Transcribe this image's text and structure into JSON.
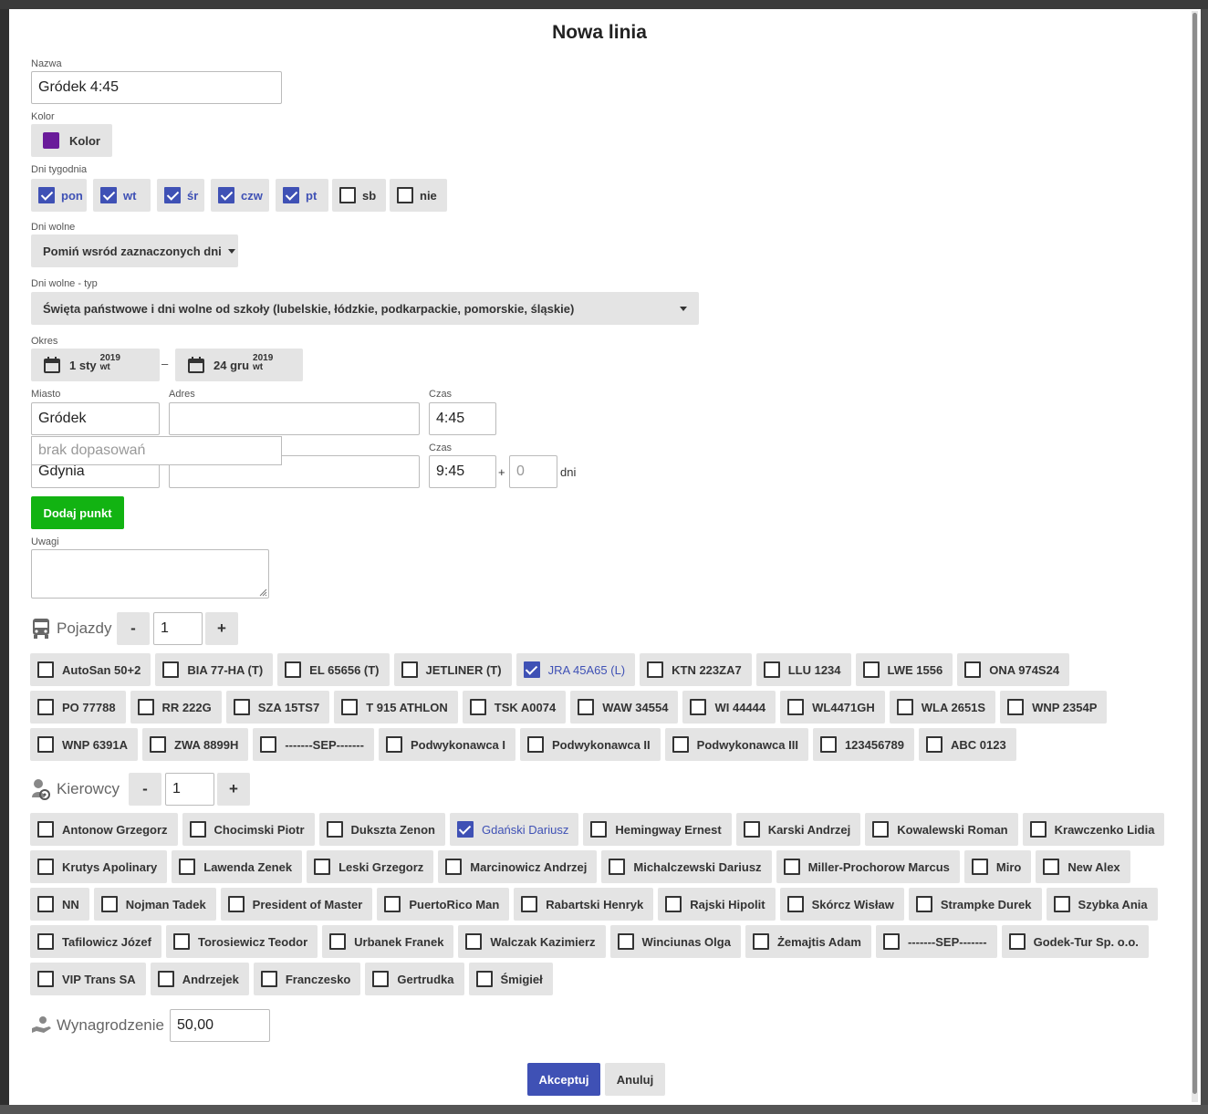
{
  "dialog": {
    "title": "Nowa linia"
  },
  "name": {
    "label": "Nazwa",
    "value": "Gródek 4:45"
  },
  "color": {
    "label": "Kolor",
    "button_label": "Kolor",
    "swatch": "#6a1b9a"
  },
  "weekdays": {
    "label": "Dni tygodnia",
    "items": [
      {
        "label": "pon",
        "checked": true
      },
      {
        "label": "wt",
        "checked": true
      },
      {
        "label": "śr",
        "checked": true
      },
      {
        "label": "czw",
        "checked": true
      },
      {
        "label": "pt",
        "checked": true
      },
      {
        "label": "sb",
        "checked": false
      },
      {
        "label": "nie",
        "checked": false
      }
    ]
  },
  "holidays": {
    "label": "Dni wolne",
    "value": "Pomiń wsród zaznaczonych dni"
  },
  "holiday_type": {
    "label": "Dni wolne - typ",
    "value": "Święta państwowe i dni wolne od szkoły (lubelskie, łódzkie, podkarpackie, pomorskie, śląskie)"
  },
  "period": {
    "label": "Okres",
    "separator": "–",
    "from": {
      "day": "1 sty",
      "year": "2019",
      "weekday": "wt"
    },
    "to": {
      "day": "24 gru",
      "year": "2019",
      "weekday": "wt"
    }
  },
  "route": {
    "labels": {
      "city": "Miasto",
      "address": "Adres",
      "time": "Czas"
    },
    "start": {
      "city": "Gródek",
      "address": "",
      "time": "4:45"
    },
    "autocomplete": "brak dopasowań",
    "end": {
      "city": "Gdynia",
      "address": "",
      "time": "9:45",
      "plus": "+",
      "days_placeholder": "0",
      "days_unit": "dni"
    },
    "add_point_label": "Dodaj punkt"
  },
  "notes": {
    "label": "Uwagi",
    "value": ""
  },
  "vehicles": {
    "title": "Pojazdy",
    "minus": "-",
    "plus": "+",
    "count": "1",
    "items": [
      {
        "label": "AutoSan 50+2",
        "checked": false
      },
      {
        "label": "BIA 77-HA (T)",
        "checked": false
      },
      {
        "label": "EL 65656 (T)",
        "checked": false
      },
      {
        "label": "JETLINER (T)",
        "checked": false
      },
      {
        "label": "JRA 45A65 (L)",
        "checked": true
      },
      {
        "label": "KTN 223ZA7",
        "checked": false
      },
      {
        "label": "LLU 1234",
        "checked": false
      },
      {
        "label": "LWE 1556",
        "checked": false
      },
      {
        "label": "ONA 974S24",
        "checked": false
      },
      {
        "label": "PO 77788",
        "checked": false
      },
      {
        "label": "RR 222G",
        "checked": false
      },
      {
        "label": "SZA 15TS7",
        "checked": false
      },
      {
        "label": "T 915 ATHLON",
        "checked": false
      },
      {
        "label": "TSK A0074",
        "checked": false
      },
      {
        "label": "WAW 34554",
        "checked": false
      },
      {
        "label": "WI 44444",
        "checked": false
      },
      {
        "label": "WL4471GH",
        "checked": false
      },
      {
        "label": "WLA 2651S",
        "checked": false
      },
      {
        "label": "WNP 2354P",
        "checked": false
      },
      {
        "label": "WNP 6391A",
        "checked": false
      },
      {
        "label": "ZWA 8899H",
        "checked": false
      },
      {
        "label": "-------SEP-------",
        "checked": false
      },
      {
        "label": "Podwykonawca I",
        "checked": false
      },
      {
        "label": "Podwykonawca II",
        "checked": false
      },
      {
        "label": "Podwykonawca III",
        "checked": false
      },
      {
        "label": "123456789",
        "checked": false
      },
      {
        "label": "ABC 0123",
        "checked": false
      }
    ]
  },
  "drivers": {
    "title": "Kierowcy",
    "minus": "-",
    "plus": "+",
    "count": "1",
    "items": [
      {
        "label": "Antonow Grzegorz",
        "checked": false
      },
      {
        "label": "Chocimski Piotr",
        "checked": false
      },
      {
        "label": "Dukszta Zenon",
        "checked": false
      },
      {
        "label": "Gdański Dariusz",
        "checked": true
      },
      {
        "label": "Hemingway Ernest",
        "checked": false
      },
      {
        "label": "Karski Andrzej",
        "checked": false
      },
      {
        "label": "Kowalewski Roman",
        "checked": false
      },
      {
        "label": "Krawczenko Lidia",
        "checked": false
      },
      {
        "label": "Krutys Apolinary",
        "checked": false
      },
      {
        "label": "Lawenda Zenek",
        "checked": false
      },
      {
        "label": "Leski Grzegorz",
        "checked": false
      },
      {
        "label": "Marcinowicz Andrzej",
        "checked": false
      },
      {
        "label": "Michalczewski Dariusz",
        "checked": false
      },
      {
        "label": "Miller-Prochorow Marcus",
        "checked": false
      },
      {
        "label": "Miro",
        "checked": false
      },
      {
        "label": "New Alex",
        "checked": false
      },
      {
        "label": "NN",
        "checked": false
      },
      {
        "label": "Nojman Tadek",
        "checked": false
      },
      {
        "label": "President of Master",
        "checked": false
      },
      {
        "label": "PuertoRico Man",
        "checked": false
      },
      {
        "label": "Rabartski Henryk",
        "checked": false
      },
      {
        "label": "Rajski Hipolit",
        "checked": false
      },
      {
        "label": "Skórcz Wisław",
        "checked": false
      },
      {
        "label": "Strampke Durek",
        "checked": false
      },
      {
        "label": "Szybka Ania",
        "checked": false
      },
      {
        "label": "Tafilowicz Józef",
        "checked": false
      },
      {
        "label": "Torosiewicz Teodor",
        "checked": false
      },
      {
        "label": "Urbanek Franek",
        "checked": false
      },
      {
        "label": "Walczak Kazimierz",
        "checked": false
      },
      {
        "label": "Winciunas Olga",
        "checked": false
      },
      {
        "label": "Żemajtis Adam",
        "checked": false
      },
      {
        "label": "-------SEP-------",
        "checked": false
      },
      {
        "label": "Godek-Tur Sp. o.o.",
        "checked": false
      },
      {
        "label": "VIP Trans SA",
        "checked": false
      },
      {
        "label": "Andrzejek",
        "checked": false
      },
      {
        "label": "Franczesko",
        "checked": false
      },
      {
        "label": "Gertrudka",
        "checked": false
      },
      {
        "label": "Śmigieł",
        "checked": false
      }
    ]
  },
  "salary": {
    "label": "Wynagrodzenie",
    "value": "50,00"
  },
  "footer": {
    "accept": "Akceptuj",
    "cancel": "Anuluj"
  },
  "colors": {
    "accent": "#3f51b5",
    "success": "#12b312",
    "button_bg": "#e4e4e4"
  },
  "icons": {
    "vehicles": "bus-icon",
    "drivers": "driver-icon",
    "salary": "salary-hand-icon",
    "date": "calendar-icon"
  }
}
